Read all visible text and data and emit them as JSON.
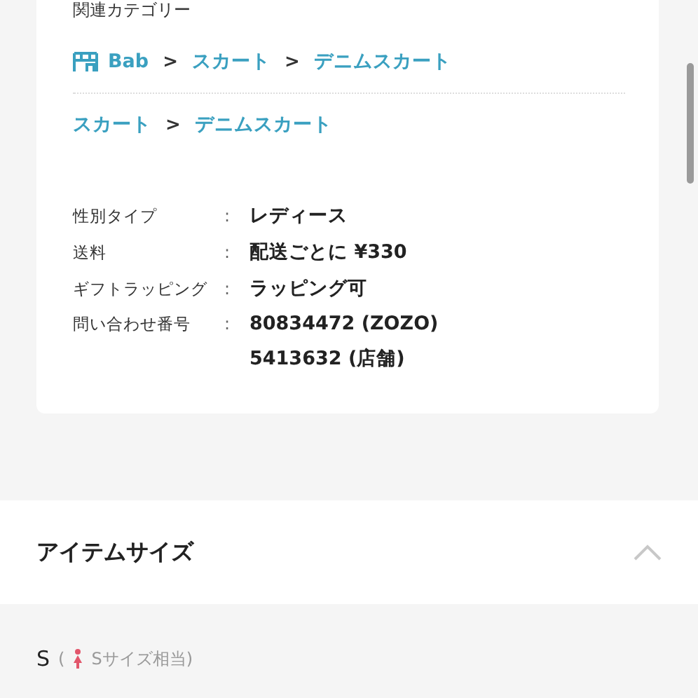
{
  "related_categories": {
    "label": "関連カテゴリー",
    "paths": [
      {
        "separator": ">",
        "segments": [
          {
            "kind": "shop",
            "text": "Bab"
          },
          {
            "kind": "category",
            "text": "スカート"
          },
          {
            "kind": "category",
            "text": "デニムスカート"
          }
        ]
      },
      {
        "separator": ">",
        "segments": [
          {
            "kind": "category",
            "text": "スカート"
          },
          {
            "kind": "category",
            "text": "デニムスカート"
          }
        ]
      }
    ]
  },
  "specs": [
    {
      "label": "性別タイプ",
      "separator": ":",
      "values": [
        "レディース"
      ]
    },
    {
      "label": "送料",
      "separator": ":",
      "values": [
        "配送ごとに ¥330"
      ]
    },
    {
      "label": "ギフトラッピング",
      "separator": ":",
      "values": [
        "ラッピング可"
      ]
    },
    {
      "label": "問い合わせ番号",
      "separator": ":",
      "values": [
        "80834472 (ZOZO)",
        "5413632 (店舗)"
      ]
    }
  ],
  "size_section": {
    "title": "アイテムサイズ",
    "expanded": true,
    "sizes": [
      {
        "size": "S",
        "note_prefix": "(",
        "kind": "female",
        "note": "Sサイズ相当)"
      }
    ]
  }
}
